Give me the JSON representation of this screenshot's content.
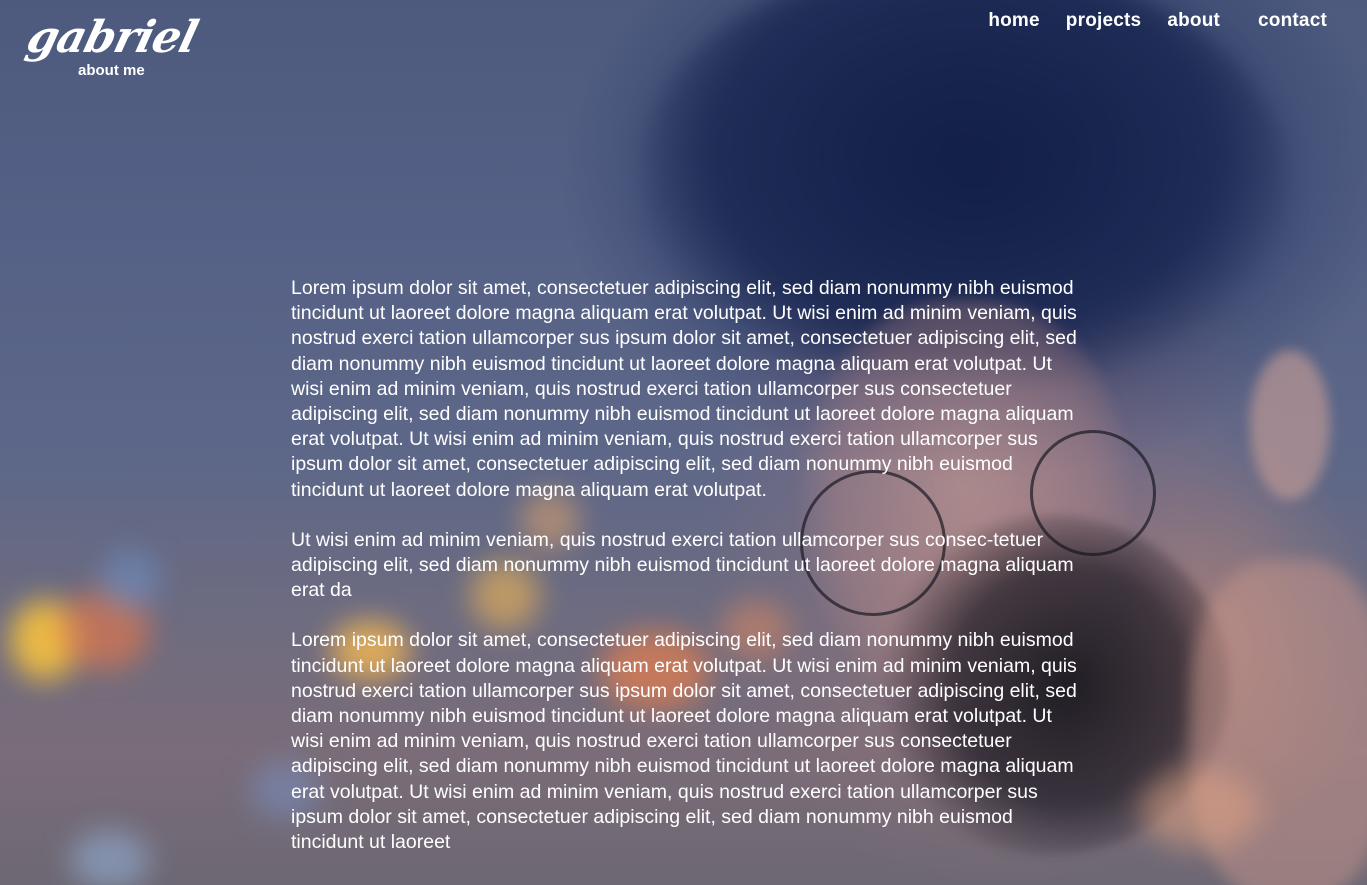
{
  "brand": {
    "logo_text": "gabriel",
    "subtitle": "about me"
  },
  "nav": {
    "items": [
      {
        "label": "home"
      },
      {
        "label": "projects"
      },
      {
        "label": "about"
      },
      {
        "label": "contact"
      }
    ]
  },
  "main": {
    "paragraphs": [
      "Lorem ipsum dolor sit amet, consectetuer adipiscing elit, sed diam nonummy nibh euismod tincidunt ut laoreet dolore magna aliquam erat volutpat. Ut wisi enim ad minim veniam, quis nostrud exerci tation ullamcorper sus ipsum dolor sit amet, consectetuer adipiscing elit, sed diam nonummy nibh euismod tincidunt ut laoreet dolore magna aliquam erat volutpat. Ut wisi enim ad minim veniam, quis nostrud exerci tation ullamcorper sus consectetuer adipiscing elit, sed diam nonummy nibh euismod tincidunt ut laoreet dolore magna aliquam erat volutpat. Ut wisi enim ad minim veniam, quis nostrud exerci tation ullamcorper sus ipsum dolor sit amet, consectetuer adipiscing elit, sed diam nonummy nibh euismod tincidunt ut laoreet dolore magna aliquam erat volutpat.",
      "Ut wisi enim ad minim veniam, quis nostrud exerci tation ullamcorper sus consec-tetuer adipiscing elit, sed diam nonummy nibh euismod tincidunt ut laoreet dolore magna aliquam erat da",
      "Lorem ipsum dolor sit amet, consectetuer adipiscing elit, sed diam nonummy nibh euismod tincidunt ut laoreet dolore magna aliquam erat volutpat. Ut wisi enim ad minim veniam, quis nostrud exerci tation ullamcorper sus ipsum dolor sit amet, consectetuer adipiscing elit, sed diam nonummy nibh euismod tincidunt ut laoreet dolore magna aliquam erat volutpat. Ut wisi enim ad minim veniam, quis nostrud exerci tation ullamcorper sus consectetuer adipiscing elit, sed diam nonummy nibh euismod tincidunt ut laoreet dolore magna aliquam erat volutpat. Ut wisi enim ad minim veniam, quis nostrud exerci tation ullamcorper sus ipsum dolor sit amet, consectetuer adipiscing elit, sed diam nonummy nibh euismod tincidunt ut laoreet"
    ]
  },
  "colors": {
    "text": "#ffffff",
    "background_tint": "#4b5a7d"
  }
}
